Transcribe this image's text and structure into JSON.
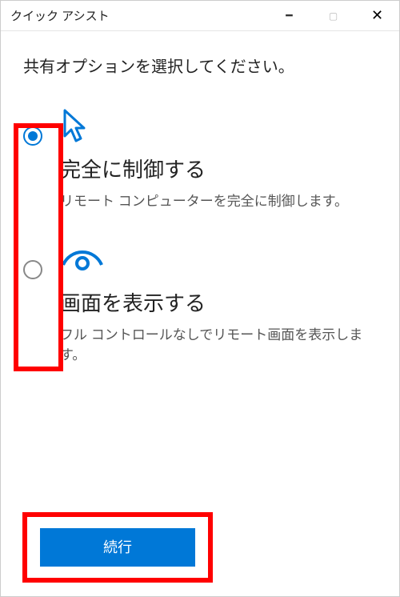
{
  "window": {
    "title": "クイック アシスト"
  },
  "heading": "共有オプションを選択してください。",
  "options": [
    {
      "selected": true,
      "icon": "cursor-icon",
      "title": "完全に制御する",
      "desc": "リモート コンピューターを完全に制御します。"
    },
    {
      "selected": false,
      "icon": "eye-icon",
      "title": "画面を表示する",
      "desc": "フル コントロールなしでリモート画面を表示します。"
    }
  ],
  "buttons": {
    "continue": "続行"
  },
  "colors": {
    "accent": "#0078d7",
    "highlight": "#ff0000"
  }
}
